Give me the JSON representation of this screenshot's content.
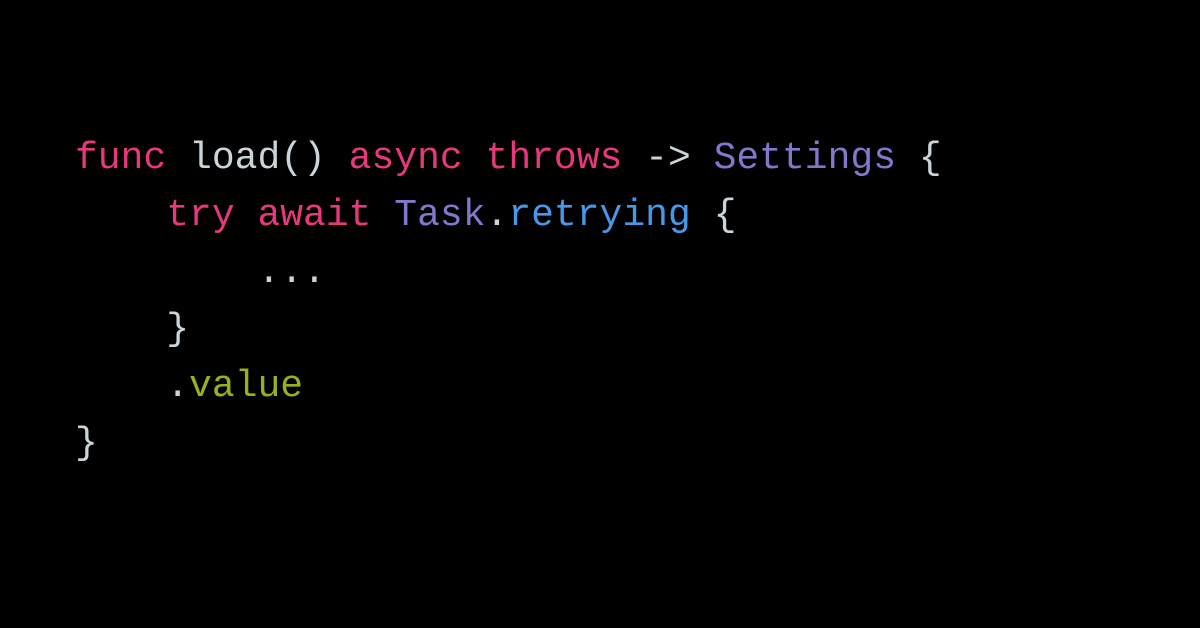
{
  "code": {
    "line1": {
      "func": "func",
      "load": "load",
      "parens": "()",
      "async": "async",
      "throws": "throws",
      "arrow": "->",
      "settings": "Settings",
      "brace_open": "{"
    },
    "line2": {
      "indent": "    ",
      "try": "try",
      "await": "await",
      "task": "Task",
      "dot": ".",
      "retrying": "retrying",
      "brace_open": "{"
    },
    "line3": {
      "indent": "        ",
      "ellipsis": "..."
    },
    "line4": {
      "indent": "    ",
      "brace_close": "}"
    },
    "line5": {
      "indent": "    ",
      "dot": ".",
      "value": "value"
    },
    "line6": {
      "brace_close": "}"
    }
  }
}
